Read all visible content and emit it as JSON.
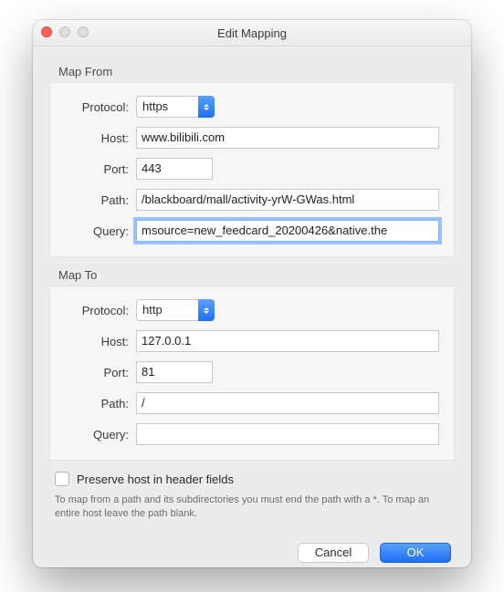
{
  "window": {
    "title": "Edit Mapping"
  },
  "map_from": {
    "legend": "Map From",
    "labels": {
      "protocol": "Protocol:",
      "host": "Host:",
      "port": "Port:",
      "path": "Path:",
      "query": "Query:"
    },
    "values": {
      "protocol": "https",
      "host": "www.bilibili.com",
      "port": "443",
      "path": "/blackboard/mall/activity-yrW-GWas.html",
      "query": "msource=new_feedcard_20200426&native.the"
    }
  },
  "map_to": {
    "legend": "Map To",
    "labels": {
      "protocol": "Protocol:",
      "host": "Host:",
      "port": "Port:",
      "path": "Path:",
      "query": "Query:"
    },
    "values": {
      "protocol": "http",
      "host": "127.0.0.1",
      "port": "81",
      "path": "/",
      "query": ""
    }
  },
  "preserve_host": {
    "checked": false,
    "label": "Preserve host in header fields"
  },
  "help_text": "To map from a path and its subdirectories you must end the path with a *. To map an entire host leave the path blank.",
  "buttons": {
    "cancel": "Cancel",
    "ok": "OK"
  }
}
